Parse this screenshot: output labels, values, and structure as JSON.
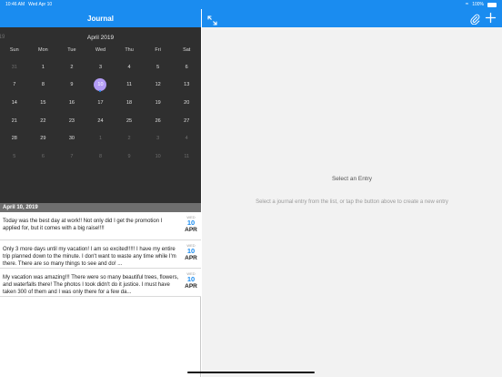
{
  "status": {
    "time": "10:46 AM",
    "date": "Wed Apr 10",
    "battery": "100%"
  },
  "master": {
    "title": "Journal"
  },
  "calendar": {
    "prev_month_label": "2019",
    "month_label": "April 2019",
    "weekdays": [
      "Sun",
      "Mon",
      "Tue",
      "Wed",
      "Thu",
      "Fri",
      "Sat"
    ],
    "weeks": [
      [
        "31",
        "1",
        "2",
        "3",
        "4",
        "5",
        "6"
      ],
      [
        "7",
        "8",
        "9",
        "10",
        "11",
        "12",
        "13"
      ],
      [
        "14",
        "15",
        "16",
        "17",
        "18",
        "19",
        "20"
      ],
      [
        "21",
        "22",
        "23",
        "24",
        "25",
        "26",
        "27"
      ],
      [
        "28",
        "29",
        "30",
        "1",
        "2",
        "3",
        "4"
      ],
      [
        "5",
        "6",
        "7",
        "8",
        "9",
        "10",
        "11"
      ]
    ],
    "selected_day": "10"
  },
  "section_header": "April 10, 2019",
  "entries": [
    {
      "text": "Today was the best day at work!!  Not only did I get the promotion I applied for, but it comes with a big raise!!!!",
      "dow": "WED",
      "day": "10",
      "month": "APR"
    },
    {
      "text": "Only 3 more days until my vacation!  I am so excited!!!!!  I have my entire trip planned down to the minute.  I don't want to waste any time while I'm there.  There are so many things to see and do!  ...",
      "dow": "WED",
      "day": "10",
      "month": "APR"
    },
    {
      "text": "My vacation was amazing!!!  There were so many beautiful trees, flowers, and waterfalls there!  The photos I took didn't do it justice.  I must have taken 300 of them and I was only there for a few da...",
      "dow": "WED",
      "day": "10",
      "month": "APR"
    }
  ],
  "detail": {
    "title": "Select an Entry",
    "subtitle": "Select a journal entry from the list, or tap the button above to create a new entry"
  },
  "colors": {
    "accent": "#1a8cf0",
    "calendar_bg": "#2f2f2f",
    "selected_day": "#b39cf5"
  },
  "icons": {
    "expand": "expand-icon",
    "attach": "paperclip-icon",
    "add": "plus-icon"
  }
}
